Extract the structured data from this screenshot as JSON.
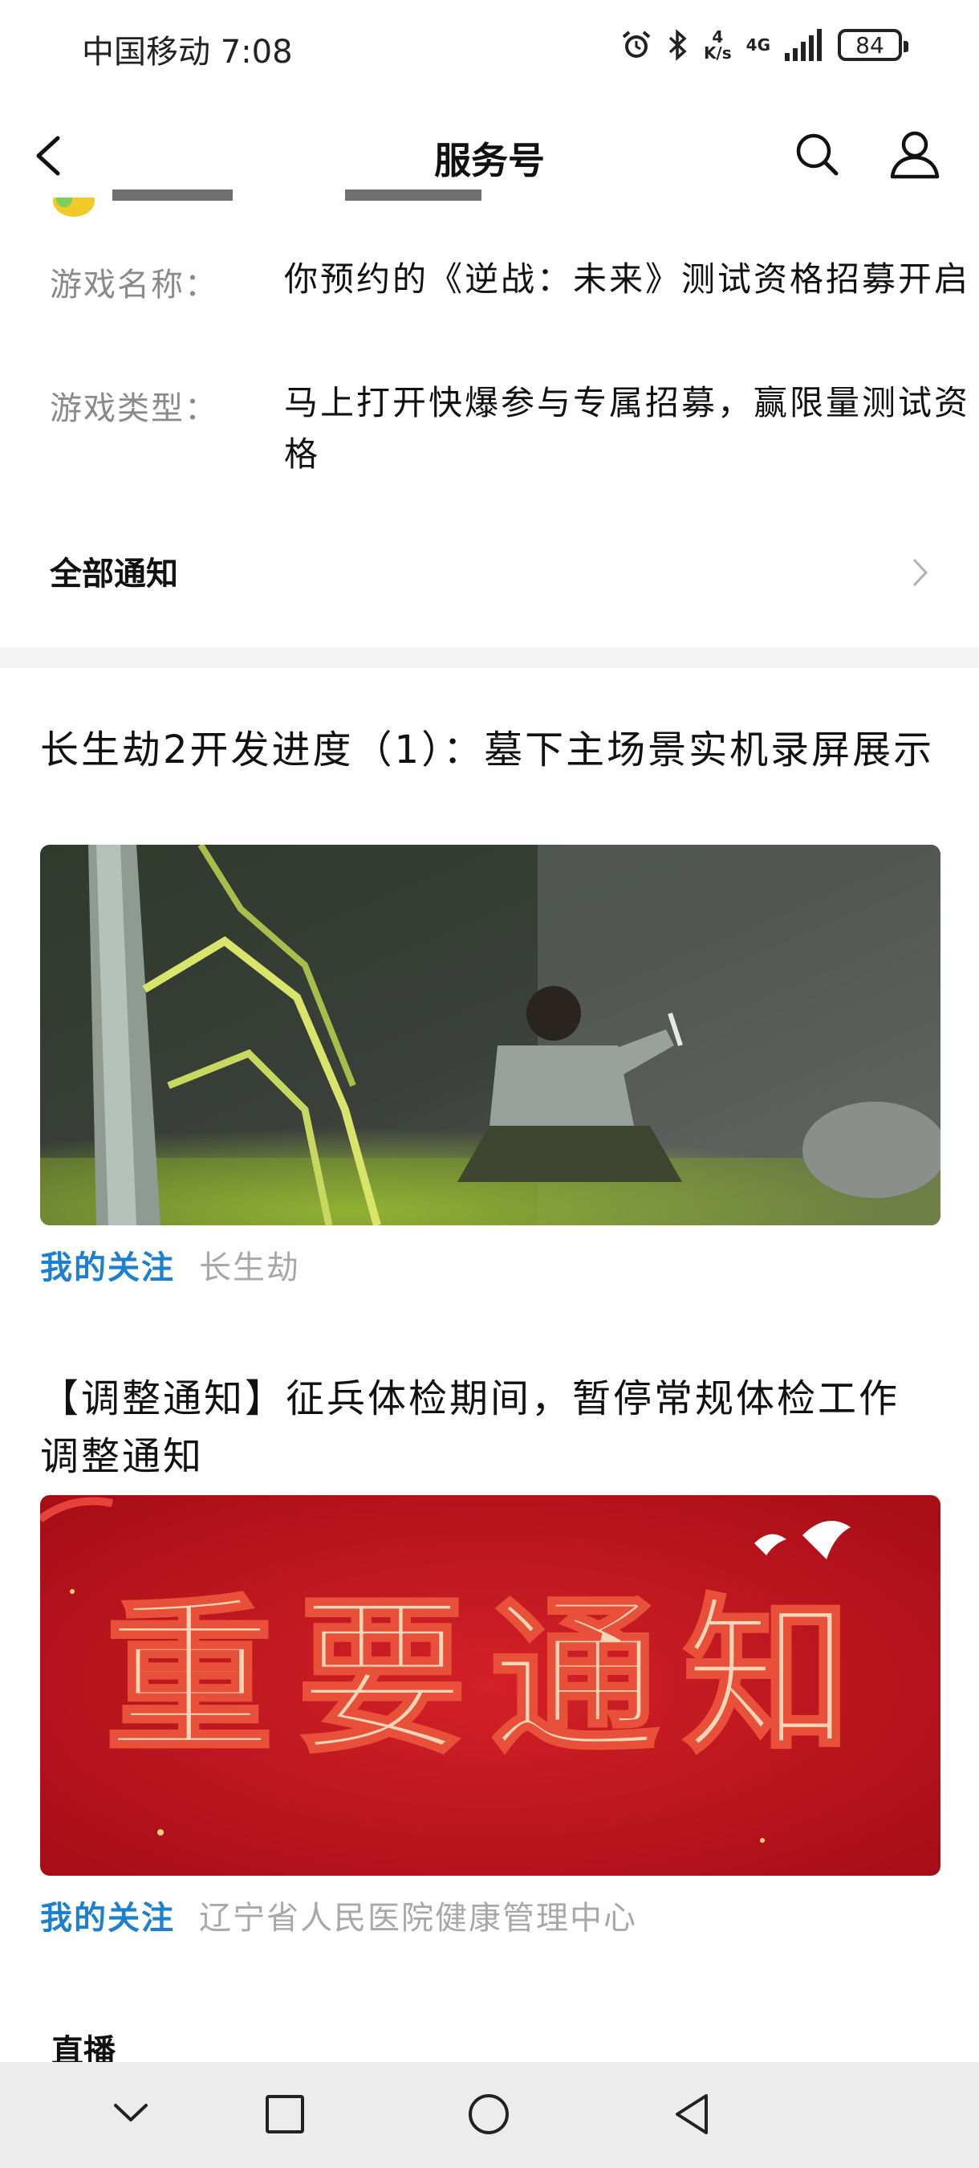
{
  "status_bar": {
    "carrier_time": "中国移动 7:08",
    "speed_value": "4",
    "speed_unit": "K/s",
    "network": "4G",
    "battery": "84"
  },
  "nav": {
    "title": "服务号"
  },
  "info": {
    "rows": [
      {
        "label": "游戏名称：",
        "value": "你预约的《逆战：未来》测试资格招募开启"
      },
      {
        "label": "游戏类型：",
        "value": "马上打开快爆参与专属招募，赢限量测试资格"
      }
    ],
    "all_notice": "全部通知"
  },
  "articles": [
    {
      "title": "长生劫2开发进度（1）：墓下主场景实机录屏展示",
      "tag": "我的关注",
      "source": "长生劫"
    },
    {
      "title": "【调整通知】征兵体检期间，暂停常规体检工作调整通知",
      "tag": "我的关注",
      "source": "辽宁省人民医院健康管理中心",
      "image_text": "重要通知"
    }
  ],
  "live_label": "直播",
  "colors": {
    "accent_blue": "#1d7fcf",
    "notice_red": "#c8141c"
  }
}
